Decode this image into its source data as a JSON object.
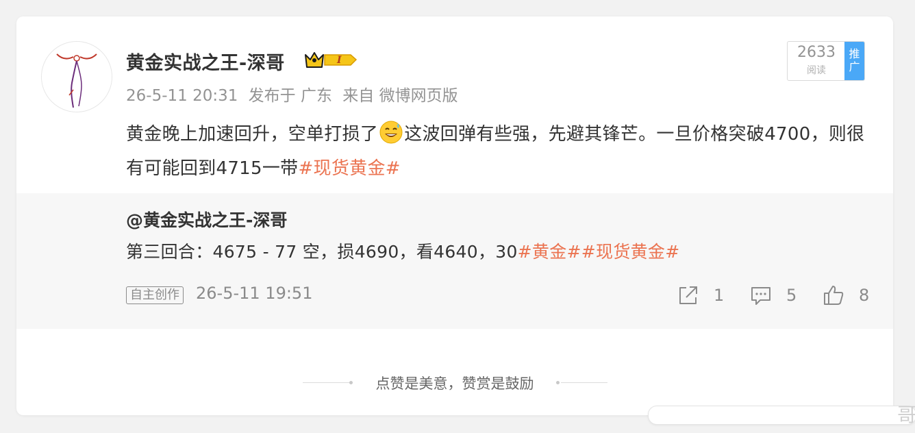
{
  "post": {
    "username": "黄金实战之王-深哥",
    "vip_level": "I",
    "meta": {
      "time": "26-5-11 20:31",
      "location": "发布于 广东",
      "source": "来自 微博网页版"
    },
    "reads": {
      "count": "2633",
      "label": "阅读"
    },
    "promote_label": "推广",
    "text_part1": "黄金晚上加速回升，空单打损了",
    "text_emoji": "sweat-smile-emoji",
    "text_part2": "这波回弹有些强，先避其锋芒。一旦价格突破4700，则很有可能回到4715一带",
    "text_tag": "#现货黄金#"
  },
  "quote": {
    "author": "@黄金实战之王-深哥",
    "text_plain": "第三回合：4675 - 77 空，损4690，看4640，30",
    "tag1": "#黄金#",
    "tag2": "#现货黄金#",
    "badge": "自主创作",
    "time": "26-5-11 19:51",
    "actions": {
      "share_count": "1",
      "comment_count": "5",
      "like_count": "8"
    }
  },
  "footer": {
    "text": "点赞是美意，赞赏是鼓励"
  },
  "colors": {
    "accent_tag": "#eb7350",
    "promote_bg": "#4aa8f7",
    "crown_gold": "#f5c518"
  }
}
